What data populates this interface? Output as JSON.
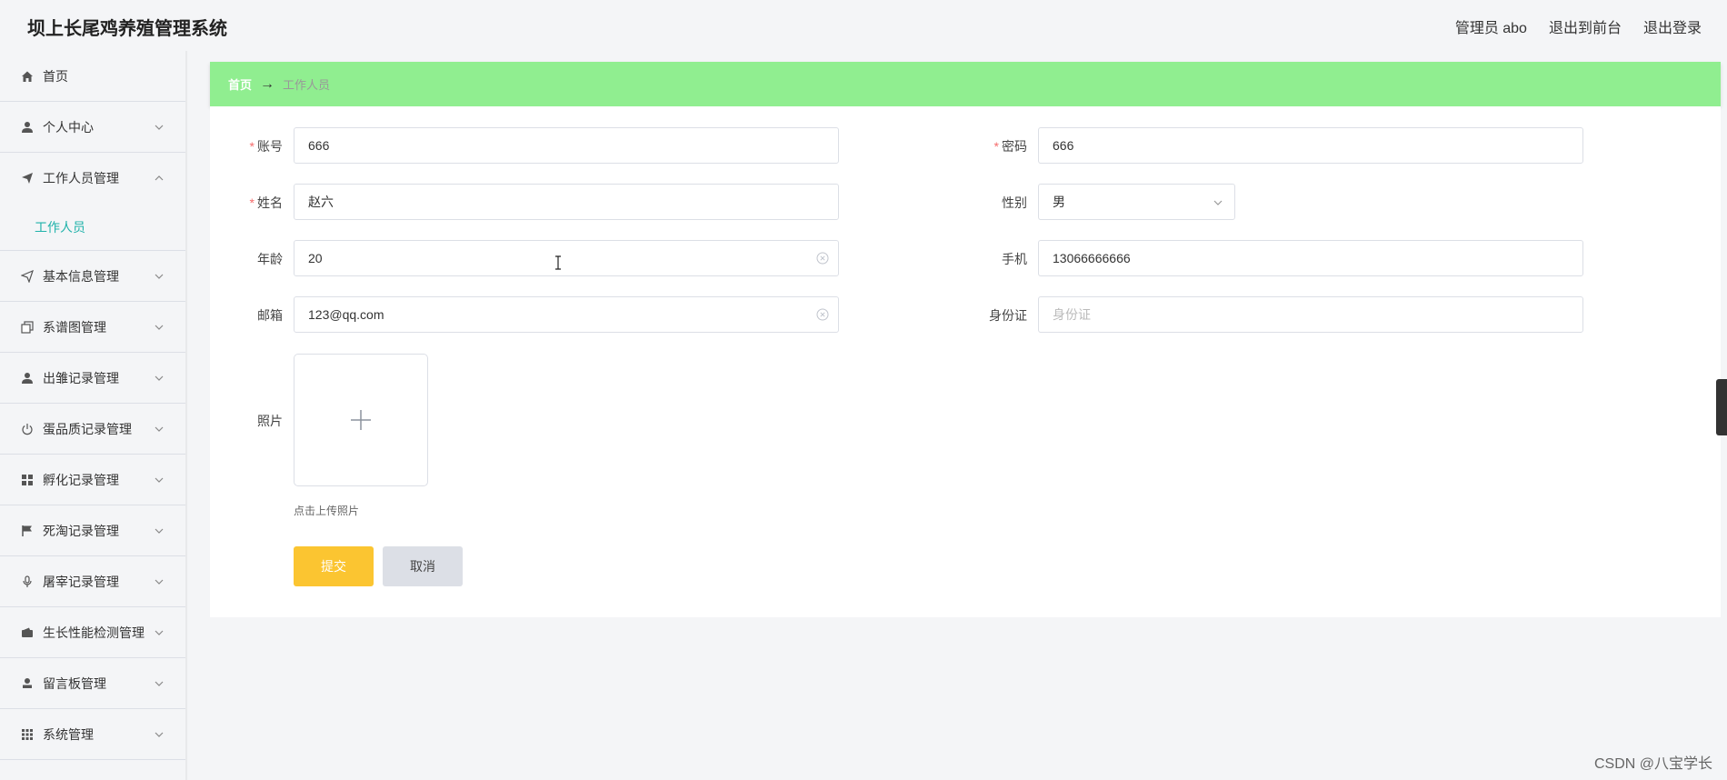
{
  "app": {
    "title": "坝上长尾鸡养殖管理系统",
    "user_label": "管理员 abo",
    "to_front_label": "退出到前台",
    "logout_label": "退出登录"
  },
  "sidebar": {
    "items": [
      {
        "label": "首页",
        "icon": "home-icon",
        "expanded": false,
        "has_children": false
      },
      {
        "label": "个人中心",
        "icon": "user-icon",
        "expanded": false,
        "has_children": true
      },
      {
        "label": "工作人员管理",
        "icon": "send-icon",
        "expanded": true,
        "has_children": true
      },
      {
        "label": "基本信息管理",
        "icon": "send-outline-icon",
        "expanded": false,
        "has_children": true
      },
      {
        "label": "系谱图管理",
        "icon": "copy-icon",
        "expanded": false,
        "has_children": true
      },
      {
        "label": "出雏记录管理",
        "icon": "user-icon",
        "expanded": false,
        "has_children": true
      },
      {
        "label": "蛋品质记录管理",
        "icon": "power-icon",
        "expanded": false,
        "has_children": true
      },
      {
        "label": "孵化记录管理",
        "icon": "grid-icon",
        "expanded": false,
        "has_children": true
      },
      {
        "label": "死淘记录管理",
        "icon": "flag-icon",
        "expanded": false,
        "has_children": true
      },
      {
        "label": "屠宰记录管理",
        "icon": "mic-icon",
        "expanded": false,
        "has_children": true
      },
      {
        "label": "生长性能检测管理",
        "icon": "wallet-icon",
        "expanded": false,
        "has_children": true
      },
      {
        "label": "留言板管理",
        "icon": "user-stamp-icon",
        "expanded": false,
        "has_children": true
      },
      {
        "label": "系统管理",
        "icon": "apps-icon",
        "expanded": false,
        "has_children": true
      }
    ],
    "subitem_active": "工作人员"
  },
  "breadcrumb": {
    "home": "首页",
    "separator": "→",
    "current": "工作人员"
  },
  "form": {
    "account_label": "账号",
    "account_value": "666",
    "password_label": "密码",
    "password_value": "666",
    "name_label": "姓名",
    "name_value": "赵六",
    "gender_label": "性别",
    "gender_value": "男",
    "age_label": "年龄",
    "age_value": "20",
    "phone_label": "手机",
    "phone_value": "13066666666",
    "email_label": "邮箱",
    "email_value": "123@qq.com",
    "idcard_label": "身份证",
    "idcard_placeholder": "身份证",
    "photo_label": "照片",
    "photo_tip": "点击上传照片",
    "submit_label": "提交",
    "cancel_label": "取消",
    "required_mark": "*"
  },
  "watermark": "CSDN @八宝学长",
  "colors": {
    "breadcrumb_bg": "#90ee90",
    "submit_bg": "#fbc531",
    "active_sub": "#20b2aa",
    "required": "#f56c6c"
  }
}
